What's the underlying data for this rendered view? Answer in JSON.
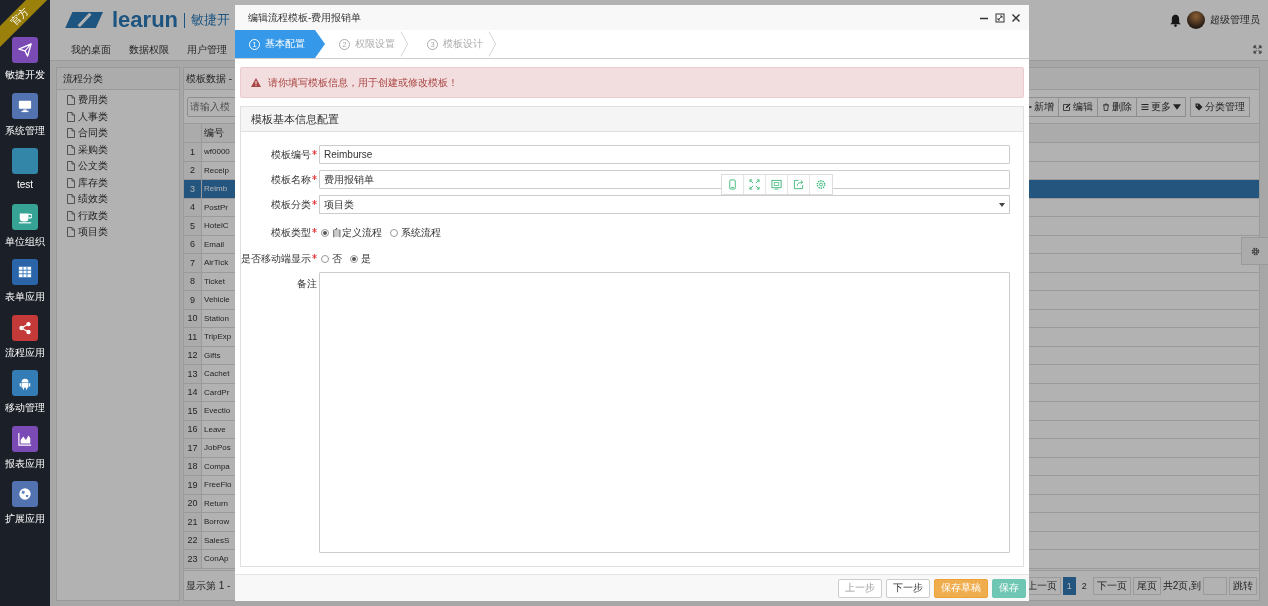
{
  "sidebar": {
    "badge": "官方",
    "items": [
      {
        "label": "敏捷开发",
        "color": "#7b4bb5"
      },
      {
        "label": "系统管理",
        "color": "#5372b0"
      },
      {
        "label": "test",
        "color": "#3386a8"
      },
      {
        "label": "单位组织",
        "color": "#36a394"
      },
      {
        "label": "表单应用",
        "color": "#2a65aa"
      },
      {
        "label": "流程应用",
        "color": "#c33a38"
      },
      {
        "label": "移动管理",
        "color": "#347cb5"
      },
      {
        "label": "报表应用",
        "color": "#7b4bb5"
      },
      {
        "label": "扩展应用",
        "color": "#5372b0"
      }
    ]
  },
  "header": {
    "logo": "learun",
    "tagline": "敏捷开",
    "nav": [
      "我的桌面",
      "数据权限",
      "用户管理"
    ],
    "user": "超级管理员"
  },
  "category_panel": {
    "title": "流程分类",
    "items": [
      "费用类",
      "人事类",
      "合同类",
      "采购类",
      "公文类",
      "库存类",
      "绩效类",
      "行政类",
      "项目类"
    ]
  },
  "grid_panel": {
    "title": "模板数据 -",
    "search": {
      "placeholder": "请输入模"
    },
    "toolbar": [
      {
        "label": "新增"
      },
      {
        "label": "编辑"
      },
      {
        "label": "删除"
      },
      {
        "label": "更多"
      },
      {
        "label": "分类管理"
      }
    ],
    "table": {
      "columns": [
        "编号"
      ],
      "rows": [
        {
          "index": "1",
          "code": "wf0000",
          "selected": false
        },
        {
          "index": "2",
          "code": "Receip",
          "selected": false
        },
        {
          "index": "3",
          "code": "Reimb",
          "selected": true
        },
        {
          "index": "4",
          "code": "PostPr",
          "selected": false
        },
        {
          "index": "5",
          "code": "HotelC",
          "selected": false
        },
        {
          "index": "6",
          "code": "Email",
          "selected": false
        },
        {
          "index": "7",
          "code": "AirTick",
          "selected": false
        },
        {
          "index": "8",
          "code": "Ticket",
          "selected": false
        },
        {
          "index": "9",
          "code": "Vehicle",
          "selected": false
        },
        {
          "index": "10",
          "code": "Station",
          "selected": false
        },
        {
          "index": "11",
          "code": "TripExp",
          "selected": false
        },
        {
          "index": "12",
          "code": "Gifts",
          "selected": false
        },
        {
          "index": "13",
          "code": "Cachet",
          "selected": false
        },
        {
          "index": "14",
          "code": "CardPr",
          "selected": false
        },
        {
          "index": "15",
          "code": "Evectio",
          "selected": false
        },
        {
          "index": "16",
          "code": "Leave",
          "selected": false
        },
        {
          "index": "17",
          "code": "JobPos",
          "selected": false
        },
        {
          "index": "18",
          "code": "Compa",
          "selected": false
        },
        {
          "index": "19",
          "code": "FreeFlo",
          "selected": false
        },
        {
          "index": "20",
          "code": "Return",
          "selected": false
        },
        {
          "index": "21",
          "code": "Borrow",
          "selected": false
        },
        {
          "index": "22",
          "code": "SalesS",
          "selected": false
        },
        {
          "index": "23",
          "code": "ConAp",
          "selected": false
        }
      ]
    },
    "footer": "显示第 1 -",
    "pagination": {
      "prev": "上一页",
      "pages": [
        {
          "label": "1",
          "selected": true
        },
        {
          "label": "2",
          "selected": false
        }
      ],
      "next": "下一页",
      "last": "尾页",
      "total": "共2页,到",
      "go": "跳转"
    }
  },
  "dialog": {
    "title": "编辑流程模板-费用报销单",
    "steps": [
      {
        "number": "1",
        "label": "基本配置",
        "selected": true
      },
      {
        "number": "2",
        "label": "权限设置",
        "selected": false
      },
      {
        "number": "3",
        "label": "模板设计",
        "selected": false
      }
    ],
    "alert": "请你填写模板信息，用于创建或修改模板！",
    "section_title": "模板基本信息配置",
    "fields": [
      {
        "kind": "text",
        "label": "模板编号",
        "required": true,
        "value": "Reimburse"
      },
      {
        "kind": "text",
        "label": "模板名称",
        "required": true,
        "value": "费用报销单"
      },
      {
        "kind": "select",
        "label": "模板分类",
        "required": true,
        "value": "项目类"
      },
      {
        "kind": "radio",
        "label": "模板类型",
        "required": true,
        "options": [
          {
            "label": "自定义流程",
            "selected": true
          },
          {
            "label": "系统流程",
            "selected": false
          }
        ]
      },
      {
        "kind": "radio",
        "label": "是否移动端显示",
        "required": true,
        "options": [
          {
            "label": "否",
            "selected": false
          },
          {
            "label": "是",
            "selected": true
          }
        ]
      },
      {
        "kind": "textarea",
        "label": "备注",
        "required": false
      }
    ],
    "buttons": [
      {
        "label": "上一步",
        "kind": "default",
        "disabled": true
      },
      {
        "label": "下一步",
        "kind": "default",
        "disabled": false
      },
      {
        "label": "保存草稿",
        "kind": "warning",
        "disabled": false
      },
      {
        "label": "保存",
        "kind": "success",
        "disabled": true
      }
    ]
  }
}
